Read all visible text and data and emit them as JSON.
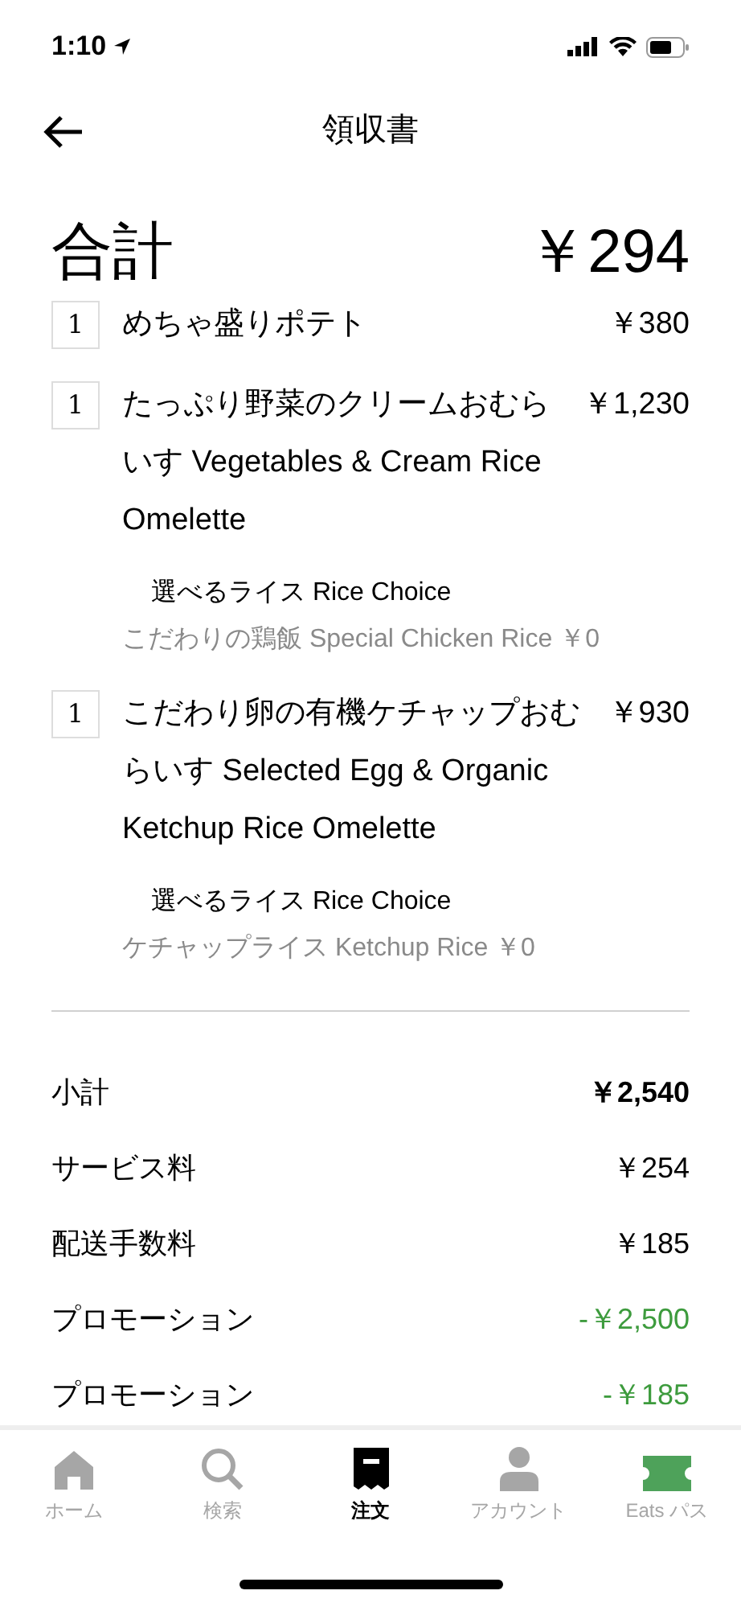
{
  "status_bar": {
    "time": "1:10"
  },
  "header": {
    "title": "領収書"
  },
  "total": {
    "label": "合計",
    "amount": "￥294"
  },
  "items": [
    {
      "quantity": "1",
      "name": "めちゃ盛りポテト",
      "price": "￥380"
    },
    {
      "quantity": "1",
      "name": "たっぷり野菜のクリームおむらいす Vegetables & Cream Rice Omelette",
      "price": "￥1,230",
      "options": [
        {
          "group": "選べるライス Rice Choice",
          "choice": "こだわりの鶏飯 Special Chicken Rice ￥0"
        }
      ]
    },
    {
      "quantity": "1",
      "name": "こだわり卵の有機ケチャップおむらいす Selected Egg & Organic Ketchup Rice Omelette",
      "price": "￥930",
      "options": [
        {
          "group": "選べるライス Rice Choice",
          "choice": "ケチャップライス Ketchup Rice ￥0"
        }
      ]
    }
  ],
  "summary": [
    {
      "kind": "subtotal",
      "label": "小計",
      "amount": "￥2,540"
    },
    {
      "kind": "fee",
      "label": "サービス料",
      "amount": "￥254"
    },
    {
      "kind": "fee",
      "label": "配送手数料",
      "amount": "￥185"
    },
    {
      "kind": "promotion",
      "label": "プロモーション",
      "amount": "-￥2,500"
    },
    {
      "kind": "promotion",
      "label": "プロモーション",
      "amount": "-￥185"
    }
  ],
  "tabs": [
    {
      "kind": "home",
      "label": "ホーム",
      "selected": false
    },
    {
      "kind": "search",
      "label": "検索",
      "selected": false
    },
    {
      "kind": "orders",
      "label": "注文",
      "selected": true
    },
    {
      "kind": "account",
      "label": "アカウント",
      "selected": false
    },
    {
      "kind": "pass",
      "label": "Eats パス",
      "selected": false
    }
  ]
}
